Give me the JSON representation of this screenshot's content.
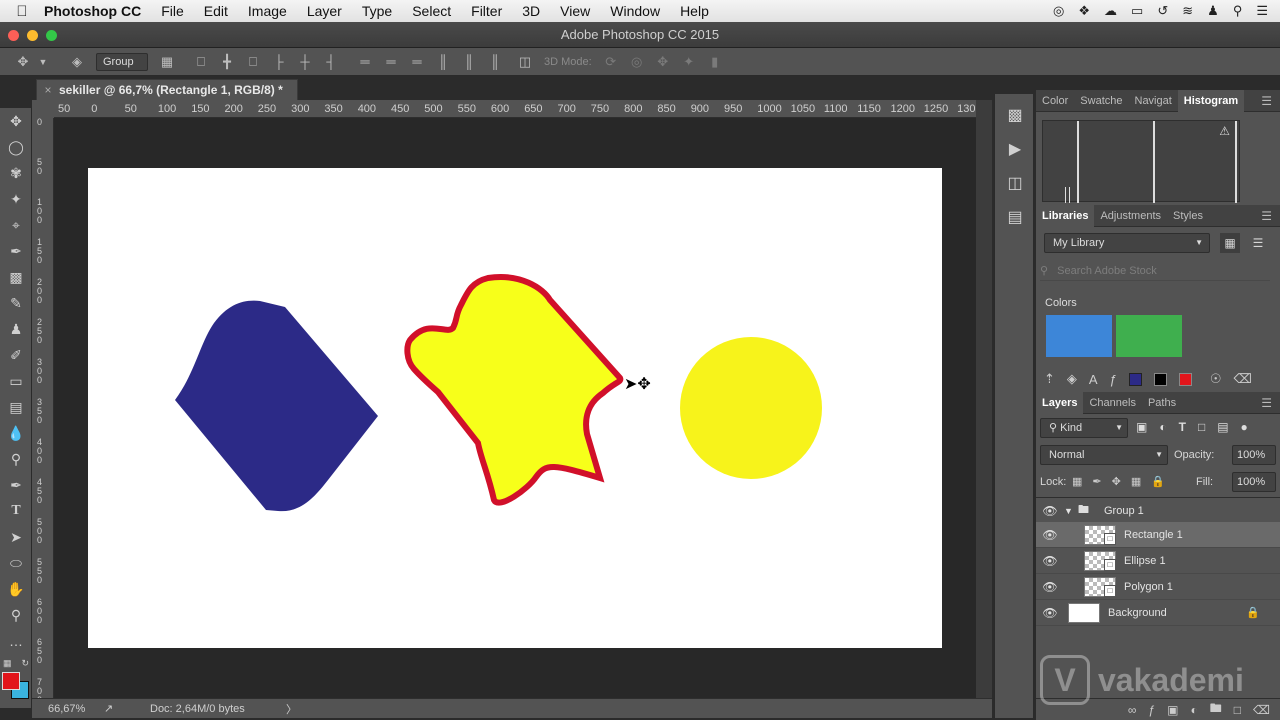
{
  "menubar": {
    "app_name": "Photoshop CC",
    "items": [
      "File",
      "Edit",
      "Image",
      "Layer",
      "Type",
      "Select",
      "Filter",
      "3D",
      "View",
      "Window",
      "Help"
    ],
    "right_icons": [
      "creative-cloud-icon",
      "dropbox-icon",
      "cloud-icon",
      "screen-icon",
      "sync-icon",
      "wifi-icon",
      "user-icon",
      "spotlight-icon",
      "list-icon"
    ]
  },
  "window": {
    "title": "Adobe Photoshop CC 2015"
  },
  "options": {
    "auto_select_value": "Group",
    "mode_label": "3D Mode:"
  },
  "document": {
    "tab_title": "sekiller @ 66,7% (Rectangle 1, RGB/8) *",
    "tab_close": "×"
  },
  "ruler": {
    "top_ticks": [
      "50",
      "0",
      "50",
      "100",
      "150",
      "200",
      "250",
      "300",
      "350",
      "400",
      "450",
      "500",
      "550",
      "600",
      "650",
      "700",
      "750",
      "800",
      "850",
      "900",
      "950",
      "1000",
      "1050",
      "1100",
      "1150",
      "1200",
      "1250",
      "130"
    ],
    "left_ticks": [
      "0",
      "5 0",
      "1 0 0",
      "1 5 0",
      "2 0 0",
      "2 5 0",
      "3 0 0",
      "3 5 0",
      "4 0 0",
      "4 5 0",
      "5 0 0",
      "5 5 0",
      "6 0 0",
      "6 5 0",
      "7 0 0"
    ]
  },
  "status": {
    "zoom": "66,67%",
    "doc": "Doc: 2,64M/0 bytes",
    "arrow": "〉"
  },
  "colors": {
    "foreground": "#e2151b",
    "background": "#3ab4e0",
    "shape_blue": "#2c2a87",
    "star_fill": "#f7ff1a",
    "star_stroke": "#d1102a",
    "circle": "#f7f31b"
  },
  "panels": {
    "top_tabs": [
      "Color",
      "Swatche",
      "Navigat",
      "Histogram"
    ],
    "mid_tabs": [
      "Libraries",
      "Adjustments",
      "Styles"
    ],
    "library_select": "My Library",
    "search_placeholder": "Search Adobe Stock",
    "colors_label": "Colors",
    "library_swatches": [
      "#3d86d8",
      "#3faf4e"
    ],
    "layers_tabs": [
      "Layers",
      "Channels",
      "Paths"
    ],
    "filter_kind": "Kind",
    "blend_mode": "Normal",
    "opacity_label": "Opacity:",
    "opacity_value": "100%",
    "lock_label": "Lock:",
    "fill_label": "Fill:",
    "fill_value": "100%",
    "layers": [
      {
        "name": "Group 1",
        "type": "group",
        "selected": false
      },
      {
        "name": "Rectangle 1",
        "type": "shape",
        "selected": true
      },
      {
        "name": "Ellipse 1",
        "type": "shape",
        "selected": false
      },
      {
        "name": "Polygon 1",
        "type": "shape",
        "selected": false
      },
      {
        "name": "Background",
        "type": "background",
        "selected": false
      }
    ]
  },
  "watermark": "vakademi"
}
